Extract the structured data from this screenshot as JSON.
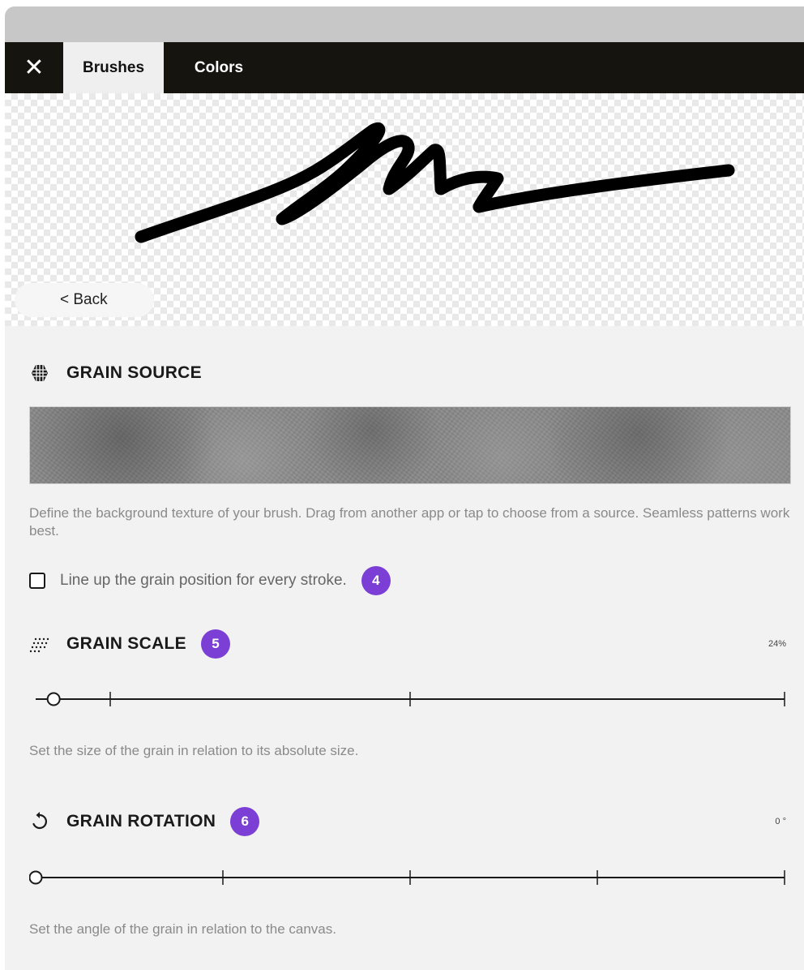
{
  "tabs": {
    "close_icon": "close-icon",
    "brushes_label": "Brushes",
    "colors_label": "Colors"
  },
  "preview": {
    "back_label": "< Back"
  },
  "grain_source": {
    "icon": "hexagon-grain-icon",
    "title": "GRAIN SOURCE",
    "description": "Define the background texture of your brush. Drag from another app or tap to choose from a source. Seamless patterns work best.",
    "checkbox_label": "Line up the grain position for every stroke.",
    "checkbox_checked": false,
    "badge": "4"
  },
  "grain_scale": {
    "icon": "dotted-grain-icon",
    "title": "GRAIN SCALE",
    "badge": "5",
    "value_label": "24%",
    "slider_fraction": 0.024,
    "description": "Set the size of the grain in relation to its absolute size."
  },
  "grain_rotation": {
    "icon": "rotate-icon",
    "title": "GRAIN ROTATION",
    "badge": "6",
    "value_label": "0 °",
    "slider_fraction": 0,
    "description": "Set the angle of the grain in relation to the canvas."
  },
  "colors": {
    "accent": "#7b3fd6",
    "tab_bar": "#15140f"
  }
}
